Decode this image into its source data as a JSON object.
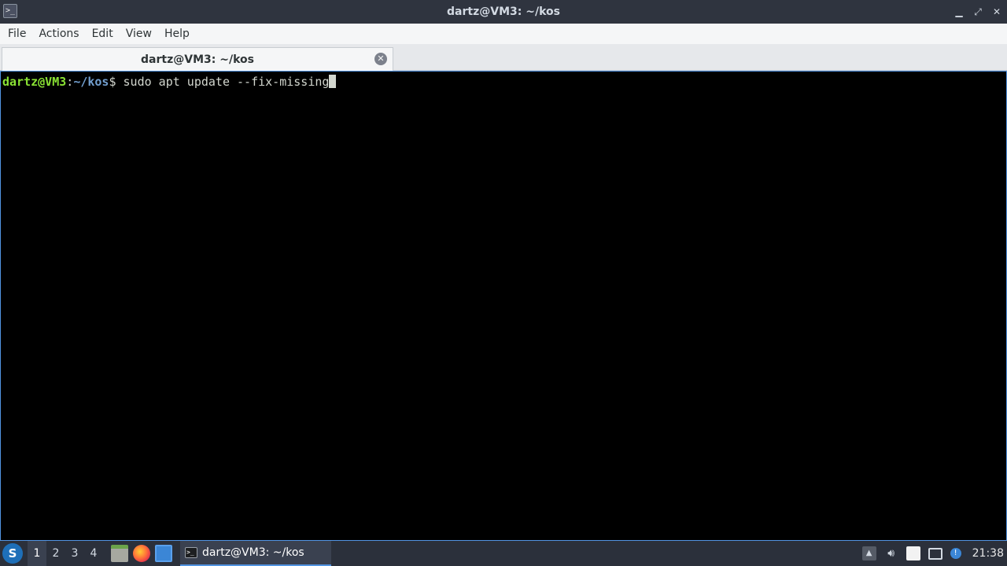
{
  "window": {
    "title": "dartz@VM3: ~/kos",
    "app_icon_glyph": ">_",
    "controls": {
      "minimize": "▁",
      "maximize": "⤢",
      "close": "✕"
    }
  },
  "menubar": {
    "items": [
      "File",
      "Actions",
      "Edit",
      "View",
      "Help"
    ]
  },
  "tabs": [
    {
      "label": "dartz@VM3: ~/kos",
      "active": true
    }
  ],
  "terminal": {
    "prompt_user_host": "dartz@VM3",
    "prompt_colon": ":",
    "prompt_path": "~/kos",
    "prompt_symbol": "$ ",
    "command": "sudo apt update --fix-missing",
    "colors": {
      "user": "#8ae234",
      "path": "#729fcf",
      "text": "#d3d7cf",
      "background": "#000000"
    }
  },
  "taskbar": {
    "desktops": [
      "1",
      "2",
      "3",
      "4"
    ],
    "active_desktop": "1",
    "launchers": [
      "file-manager-icon",
      "firefox-icon",
      "show-desktop-icon"
    ],
    "task": {
      "label": "dartz@VM3: ~/kos",
      "icon": "terminal-icon"
    },
    "tray": [
      "tray-expand-icon",
      "volume-icon",
      "clipboard-icon",
      "monitor-icon",
      "update-notifier-icon"
    ],
    "clock": "21:38"
  }
}
